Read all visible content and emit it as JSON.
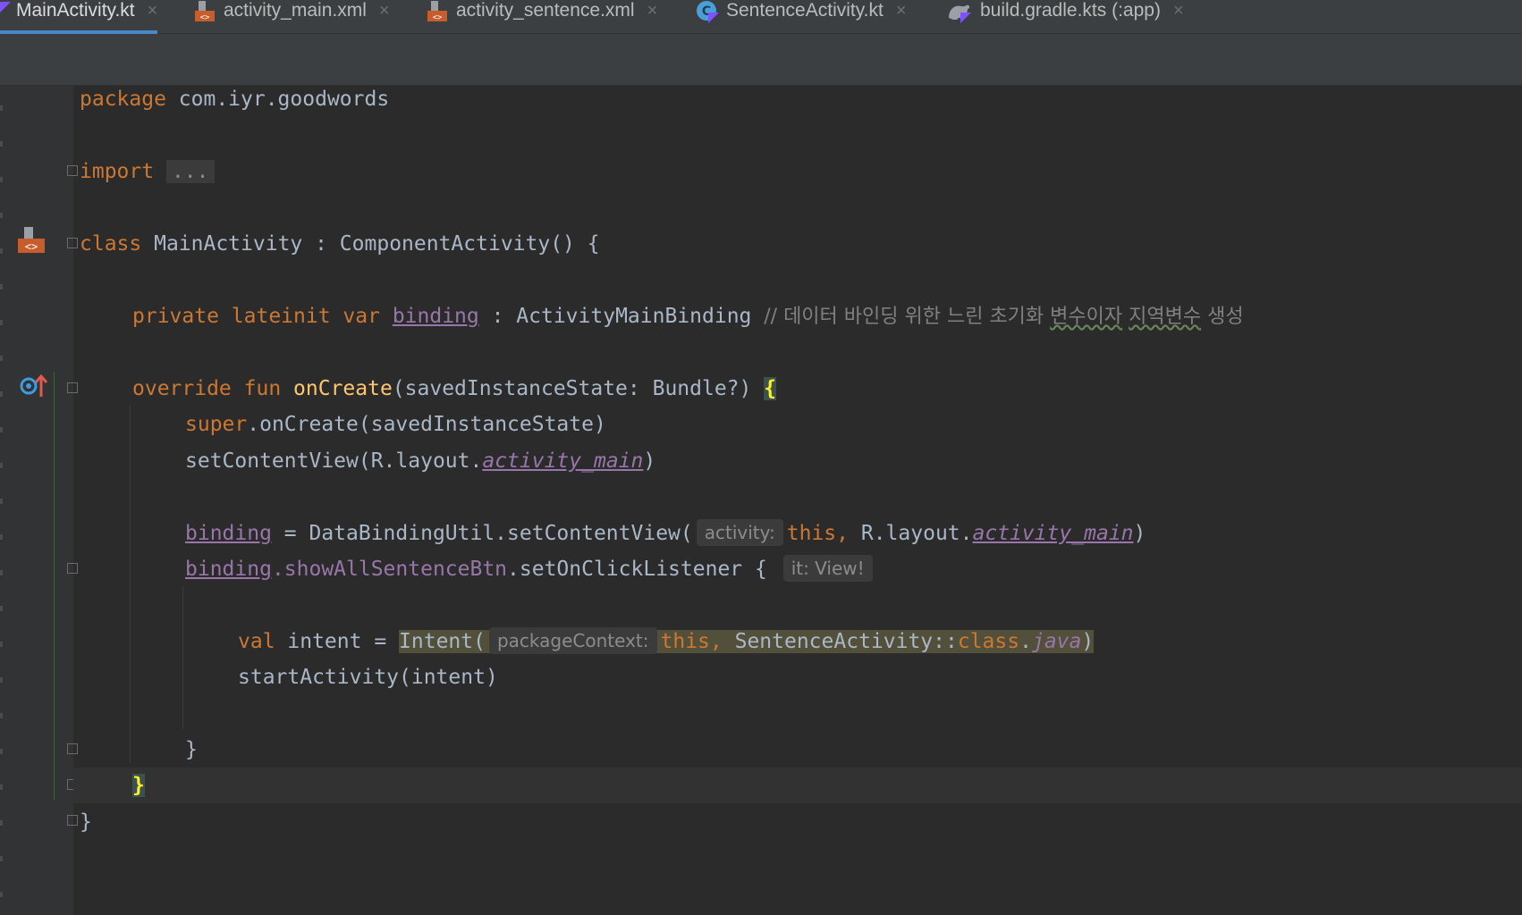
{
  "tabs": [
    {
      "label": "MainActivity.kt",
      "icon": "kotlin-file-icon",
      "active": true
    },
    {
      "label": "activity_main.xml",
      "icon": "xml-layout-icon",
      "active": false
    },
    {
      "label": "activity_sentence.xml",
      "icon": "xml-layout-icon",
      "active": false
    },
    {
      "label": "SentenceActivity.kt",
      "icon": "kotlin-class-icon",
      "active": false
    },
    {
      "label": "build.gradle.kts (:app)",
      "icon": "gradle-icon",
      "active": false
    }
  ],
  "close_glyph": "×",
  "code": {
    "l1_kw": "package",
    "l1_rest": " com.iyr.goodwords",
    "l2_kw": "import",
    "l2_fold": "...",
    "l3_kw": "class",
    "l3_rest": " MainActivity : ComponentActivity() {",
    "l4_kw": "private lateinit var",
    "l4_prop": "binding",
    "l4_type": " : ActivityMainBinding ",
    "l4_cmt1": "// 데이터 바인딩 위한 느린 초기화 ",
    "l4_cmt2": "변수이자",
    "l4_cmt3": " ",
    "l4_cmt4": "지역변수",
    "l4_cmt5": " 생성",
    "l5_kw": "override fun",
    "l5_fn": "onCreate",
    "l5_rest": "(savedInstanceState: Bundle?) ",
    "l5_brace": "{",
    "l6_kw": "super",
    "l6_rest": ".onCreate(savedInstanceState)",
    "l7_pre": "setContentView(R.layout.",
    "l7_prop": "activity_main",
    "l7_post": ")",
    "l8_prop": "binding",
    "l8_mid": " = DataBindingUtil.setContentView(",
    "l8_hint": "activity:",
    "l8_kw": "this,",
    "l8_mid2": " R.layout.",
    "l8_prop2": "activity_main",
    "l8_post": ")",
    "l9_prop": "binding",
    "l9_prop2": ".showAllSentenceBtn",
    "l9_rest": ".setOnClickListener { ",
    "l9_hint": "it: View!",
    "l10_kw": "val",
    "l10_rest": " intent = ",
    "l10_call": "Intent(",
    "l10_hint": "packageContext:",
    "l10_kw2": "this,",
    "l10_mid": " SentenceActivity::",
    "l10_kw3": "class",
    "l10_dot": ".",
    "l10_prop": "java",
    "l10_post": ")",
    "l11": "startActivity(intent)",
    "l12": "}",
    "l13": "}",
    "l14": "}"
  },
  "gutter_icons": [
    "layout-preview-icon",
    "override-method-icon"
  ],
  "colors": {
    "keyword": "#cc7832",
    "function": "#ffc66d",
    "property": "#9876aa",
    "text": "#a9b7c6",
    "comment": "#808080",
    "accent": "#4a88c7"
  }
}
